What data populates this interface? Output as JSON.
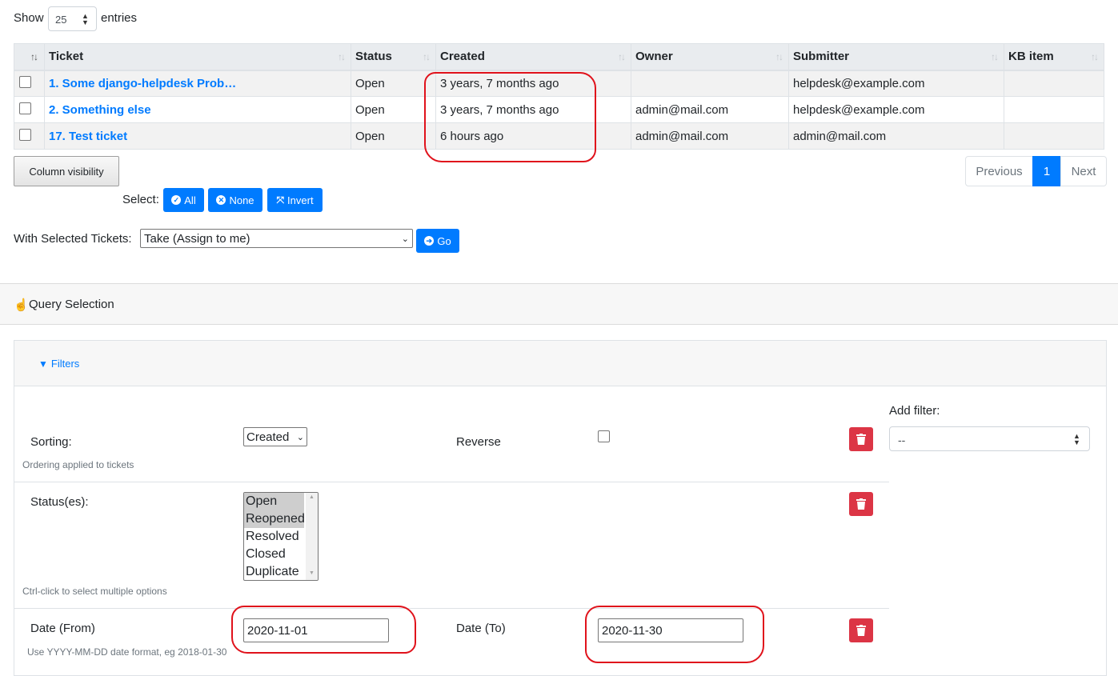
{
  "length_menu": {
    "show_label": "Show",
    "value": "25",
    "entries_label": "entries"
  },
  "table": {
    "headers": [
      "Ticket",
      "Status",
      "Created",
      "Owner",
      "Submitter",
      "KB item"
    ],
    "rows": [
      {
        "ticket": "1. Some django-helpdesk Prob…",
        "status": "Open",
        "created": "3 years, 7 months ago",
        "owner": "",
        "submitter": "helpdesk@example.com",
        "kb": ""
      },
      {
        "ticket": "2. Something else",
        "status": "Open",
        "created": "3 years, 7 months ago",
        "owner": "admin@mail.com",
        "submitter": "helpdesk@example.com",
        "kb": ""
      },
      {
        "ticket": "17. Test ticket",
        "status": "Open",
        "created": "6 hours ago",
        "owner": "admin@mail.com",
        "submitter": "admin@mail.com",
        "kb": ""
      }
    ]
  },
  "column_visibility_label": "Column visibility",
  "pagination": {
    "previous": "Previous",
    "current": "1",
    "next": "Next"
  },
  "select_bar": {
    "label": "Select:",
    "all": "All",
    "none": "None",
    "invert": "Invert"
  },
  "bulk_action": {
    "label": "With Selected Tickets:",
    "selected": "Take (Assign to me)",
    "go": "Go"
  },
  "query_selection": {
    "title": "Query Selection"
  },
  "filters": {
    "tab_label": "Filters",
    "add_filter_label": "Add filter:",
    "add_filter_value": "--",
    "sorting": {
      "label": "Sorting:",
      "value": "Created",
      "reverse_label": "Reverse",
      "hint": "Ordering applied to tickets"
    },
    "status": {
      "label": "Status(es):",
      "options": [
        "Open",
        "Reopened",
        "Resolved",
        "Closed",
        "Duplicate"
      ],
      "selected": [
        "Open",
        "Reopened"
      ],
      "hint": "Ctrl-click to select multiple options"
    },
    "date": {
      "from_label": "Date (From)",
      "from_value": "2020-11-01",
      "to_label": "Date (To)",
      "to_value": "2020-11-30",
      "hint": "Use YYYY-MM-DD date format, eg 2018-01-30"
    }
  },
  "colors": {
    "primary": "#007bff",
    "danger": "#dc3545",
    "annotation": "#e0121b"
  }
}
